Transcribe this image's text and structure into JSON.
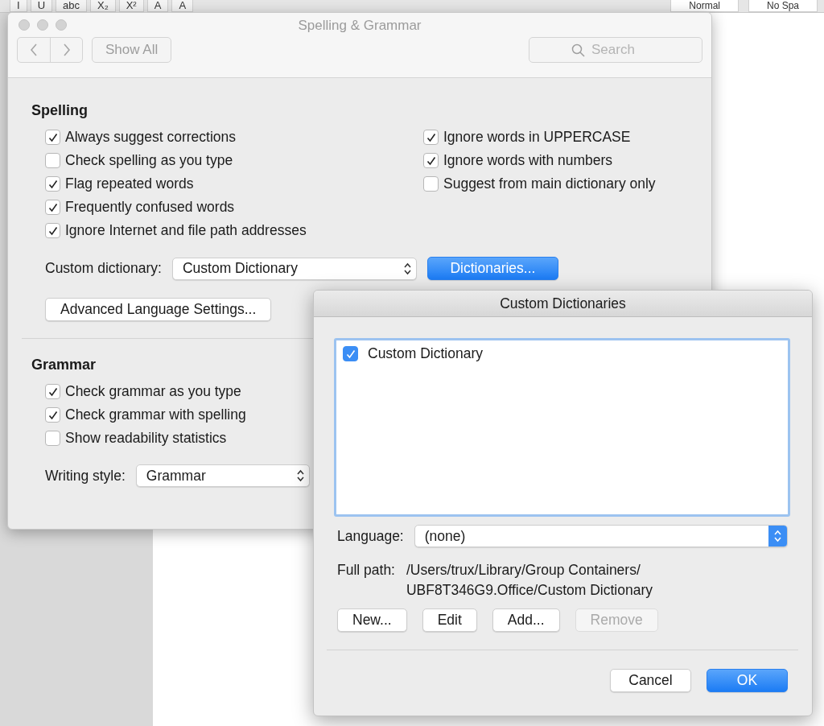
{
  "background_app": {
    "toolbar_buttons": [
      "I",
      "U",
      "abc",
      "X₂",
      "X²",
      "A",
      "A"
    ],
    "styles": [
      "Normal",
      "No Spa"
    ]
  },
  "window": {
    "title": "Spelling & Grammar",
    "show_all": "Show All",
    "search": {
      "placeholder": "Search"
    },
    "spelling": {
      "heading": "Spelling",
      "left_options": [
        {
          "label": "Always suggest corrections",
          "checked": true
        },
        {
          "label": "Check spelling as you type",
          "checked": false
        },
        {
          "label": "Flag repeated words",
          "checked": true
        },
        {
          "label": "Frequently confused words",
          "checked": true
        },
        {
          "label": "Ignore Internet and file path addresses",
          "checked": true
        }
      ],
      "right_options": [
        {
          "label": "Ignore words in UPPERCASE",
          "checked": true
        },
        {
          "label": "Ignore words with numbers",
          "checked": true
        },
        {
          "label": "Suggest from main dictionary only",
          "checked": false
        }
      ],
      "custom_dictionary": {
        "label": "Custom dictionary:",
        "value": "Custom Dictionary"
      },
      "dictionaries_button": "Dictionaries...",
      "advanced_button": "Advanced Language Settings..."
    },
    "grammar": {
      "heading": "Grammar",
      "options": [
        {
          "label": "Check grammar as you type",
          "checked": true
        },
        {
          "label": "Check grammar with spelling",
          "checked": true
        },
        {
          "label": "Show readability statistics",
          "checked": false
        }
      ],
      "writing_style": {
        "label": "Writing style:",
        "value": "Grammar"
      }
    }
  },
  "sheet": {
    "title": "Custom Dictionaries",
    "dictionaries": [
      {
        "name": "Custom Dictionary",
        "checked": true
      }
    ],
    "language": {
      "label": "Language:",
      "value": "(none)"
    },
    "full_path": {
      "label": "Full path:",
      "lines": [
        "/Users/trux/Library/Group Containers/",
        "UBF8T346G9.Office/Custom Dictionary"
      ]
    },
    "buttons": [
      {
        "label": "New...",
        "disabled": false
      },
      {
        "label": "Edit",
        "disabled": false
      },
      {
        "label": "Add...",
        "disabled": false
      },
      {
        "label": "Remove",
        "disabled": true
      }
    ],
    "cancel": "Cancel",
    "ok": "OK"
  }
}
